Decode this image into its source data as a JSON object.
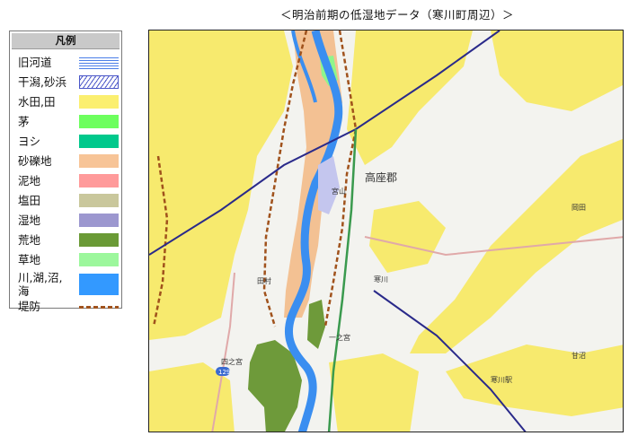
{
  "title": "＜明治前期の低湿地データ（寒川町周辺）＞",
  "legend": {
    "header": "凡例",
    "items": [
      {
        "label": "旧河道",
        "fill": "#ffffff",
        "pattern": "blue-lines"
      },
      {
        "label": "干潟,砂浜",
        "fill": "#ffffff",
        "pattern": "hatch"
      },
      {
        "label": "水田,田",
        "fill": "#fbef6f"
      },
      {
        "label": "茅",
        "fill": "#6dff5e"
      },
      {
        "label": "ヨシ",
        "fill": "#00c98c"
      },
      {
        "label": "砂礫地",
        "fill": "#f7c497"
      },
      {
        "label": "泥地",
        "fill": "#ff9a9a"
      },
      {
        "label": "塩田",
        "fill": "#c9c79c"
      },
      {
        "label": "湿地",
        "fill": "#9c97cf"
      },
      {
        "label": "荒地",
        "fill": "#6a9a36"
      },
      {
        "label": "草地",
        "fill": "#9cf79c"
      },
      {
        "label": "川,湖,沼,\n海",
        "fill": "#3399ff"
      },
      {
        "label": "堤防",
        "fill": "#ffffff",
        "pattern": "dashed-brown"
      }
    ]
  },
  "map": {
    "labels": {
      "district": "高座郡",
      "miyayama": "宮山",
      "sanagawa": "寒川",
      "ichinomiya": "一之宮",
      "tamura": "田村",
      "shinozaki": "四之宮",
      "amanuma": "甘沼",
      "sanagawa_station": "寒川駅",
      "route": "129",
      "okami": "岡田"
    }
  }
}
